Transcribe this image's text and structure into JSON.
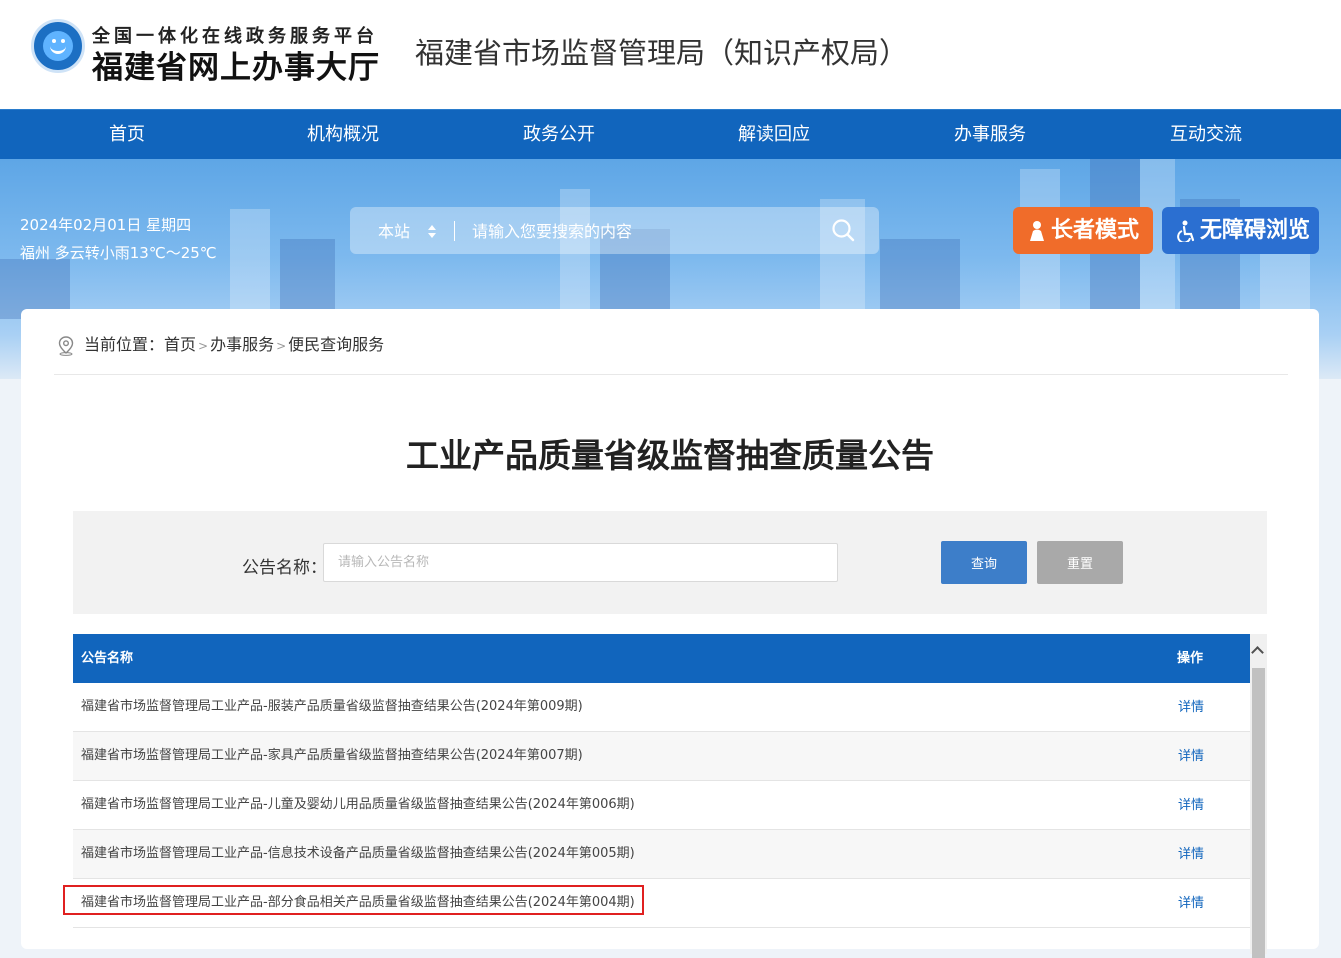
{
  "header": {
    "logo_line1": "全国一体化在线政务服务平台",
    "logo_line2": "福建省网上办事大厅",
    "title": "福建省市场监督管理局（知识产权局）"
  },
  "nav": {
    "items": [
      {
        "label": "首页"
      },
      {
        "label": "机构概况"
      },
      {
        "label": "政务公开"
      },
      {
        "label": "解读回应"
      },
      {
        "label": "办事服务"
      },
      {
        "label": "互动交流"
      }
    ]
  },
  "banner": {
    "date": "2024年02月01日 星期四",
    "weather": "福州 多云转小雨13℃～25℃",
    "search_scope": "本站",
    "search_placeholder": "请输入您要搜索的内容",
    "elder_mode_label": "长者模式",
    "accessible_label": "无障碍浏览"
  },
  "breadcrumb": {
    "prefix": "当前位置：",
    "items": [
      "首页",
      "办事服务",
      "便民查询服务"
    ],
    "sep": ">"
  },
  "page_title": "工业产品质量省级监督抽查质量公告",
  "filter": {
    "label": "公告名称：",
    "placeholder": "请输入公告名称",
    "query_label": "查询",
    "reset_label": "重置"
  },
  "table": {
    "col_name": "公告名称",
    "col_op": "操作",
    "rows": [
      {
        "name": "福建省市场监督管理局工业产品-服装产品质量省级监督抽查结果公告(2024年第009期)",
        "op": "详情"
      },
      {
        "name": "福建省市场监督管理局工业产品-家具产品质量省级监督抽查结果公告(2024年第007期)",
        "op": "详情"
      },
      {
        "name": "福建省市场监督管理局工业产品-儿童及婴幼儿用品质量省级监督抽查结果公告(2024年第006期)",
        "op": "详情"
      },
      {
        "name": "福建省市场监督管理局工业产品-信息技术设备产品质量省级监督抽查结果公告(2024年第005期)",
        "op": "详情"
      },
      {
        "name": "福建省市场监督管理局工业产品-部分食品相关产品质量省级监督抽查结果公告(2024年第004期)",
        "op": "详情"
      }
    ]
  },
  "colors": {
    "nav_blue": "#1165bd",
    "elder_orange": "#f06c2a",
    "accessible_blue": "#2b6fd1",
    "highlight_red": "#e02020"
  }
}
